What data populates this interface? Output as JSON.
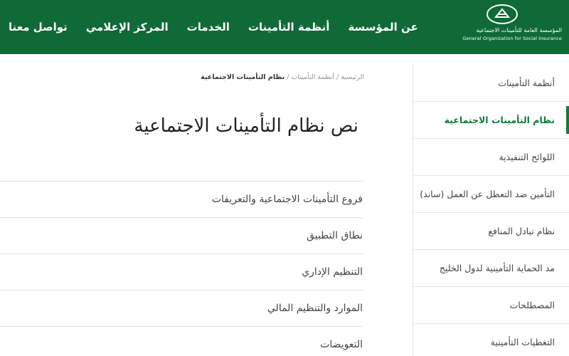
{
  "header": {
    "nav": [
      "عن المؤسسة",
      "أنظمة التأمينات",
      "الخدمات",
      "المركز الإعلامي",
      "تواصل معنا"
    ],
    "brand_ar": "المؤسسة العامة للتأمينات الاجتماعية",
    "brand_en": "General Organization for Social Insurance"
  },
  "breadcrumb": {
    "home": "الرئيسية",
    "parent": "أنظمة التأمينات",
    "current": "نظام التأمينات الاجتماعية",
    "separator": "/"
  },
  "page": {
    "title": "نص نظام التأمينات الاجتماعية"
  },
  "sections": [
    "فروع التأمينات الاجتماعية والتعريفات",
    "نطاق التطبيق",
    "التنظيم الإداري",
    "الموارد والتنظيم المالي",
    "التعويضات"
  ],
  "sidebar": {
    "items": [
      "أنظمة التأمينات",
      "نظام التأمينات الاجتماعية",
      "اللوائح التنفيذية",
      "التأمين ضد التعطل عن العمل (ساند)",
      "نظام تبادل المنافع",
      "مد الحماية التأمينية لدول الخليج",
      "المصطلحات",
      "التغطيات التأمينية"
    ],
    "active_index": 1
  },
  "colors": {
    "header_bg": "#0f6a37",
    "accent": "#0f7a3a"
  }
}
